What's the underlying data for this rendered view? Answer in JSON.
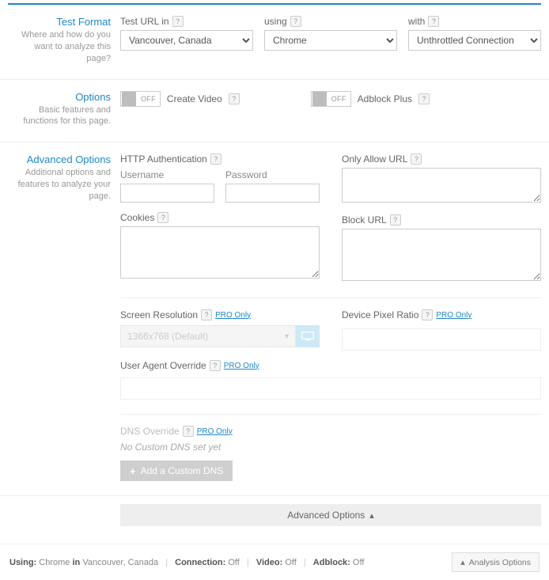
{
  "testFormat": {
    "title": "Test Format",
    "desc": "Where and how do you want to analyze this page?",
    "fields": {
      "urlLabel": "Test URL in",
      "urlValue": "Vancouver, Canada",
      "browserLabel": "using",
      "browserValue": "Chrome",
      "connLabel": "with",
      "connValue": "Unthrottled Connection"
    }
  },
  "options": {
    "title": "Options",
    "desc": "Basic features and functions for this page.",
    "toggleState": "OFF",
    "createVideo": "Create Video",
    "adblock": "Adblock Plus"
  },
  "advanced": {
    "title": "Advanced Options",
    "desc": "Additional options and features to analyze your page.",
    "httpAuth": "HTTP Authentication",
    "username": "Username",
    "password": "Password",
    "cookies": "Cookies",
    "onlyAllow": "Only Allow URL",
    "blockUrl": "Block URL",
    "screenRes": "Screen Resolution",
    "screenResValue": "1366x768 (Default)",
    "devicePixel": "Device Pixel Ratio",
    "uaOverride": "User Agent Override",
    "dnsOverride": "DNS Override",
    "dnsNote": "No Custom DNS set yet",
    "addDns": "Add a Custom DNS",
    "pro": "PRO Only",
    "collapse": "Advanced Options"
  },
  "footer": {
    "using": "Using:",
    "browser": "Chrome",
    "in": "in",
    "location": "Vancouver, Canada",
    "conn": "Connection:",
    "video": "Video:",
    "adblock": "Adblock:",
    "off": "Off",
    "analysis": "Analysis Options"
  }
}
